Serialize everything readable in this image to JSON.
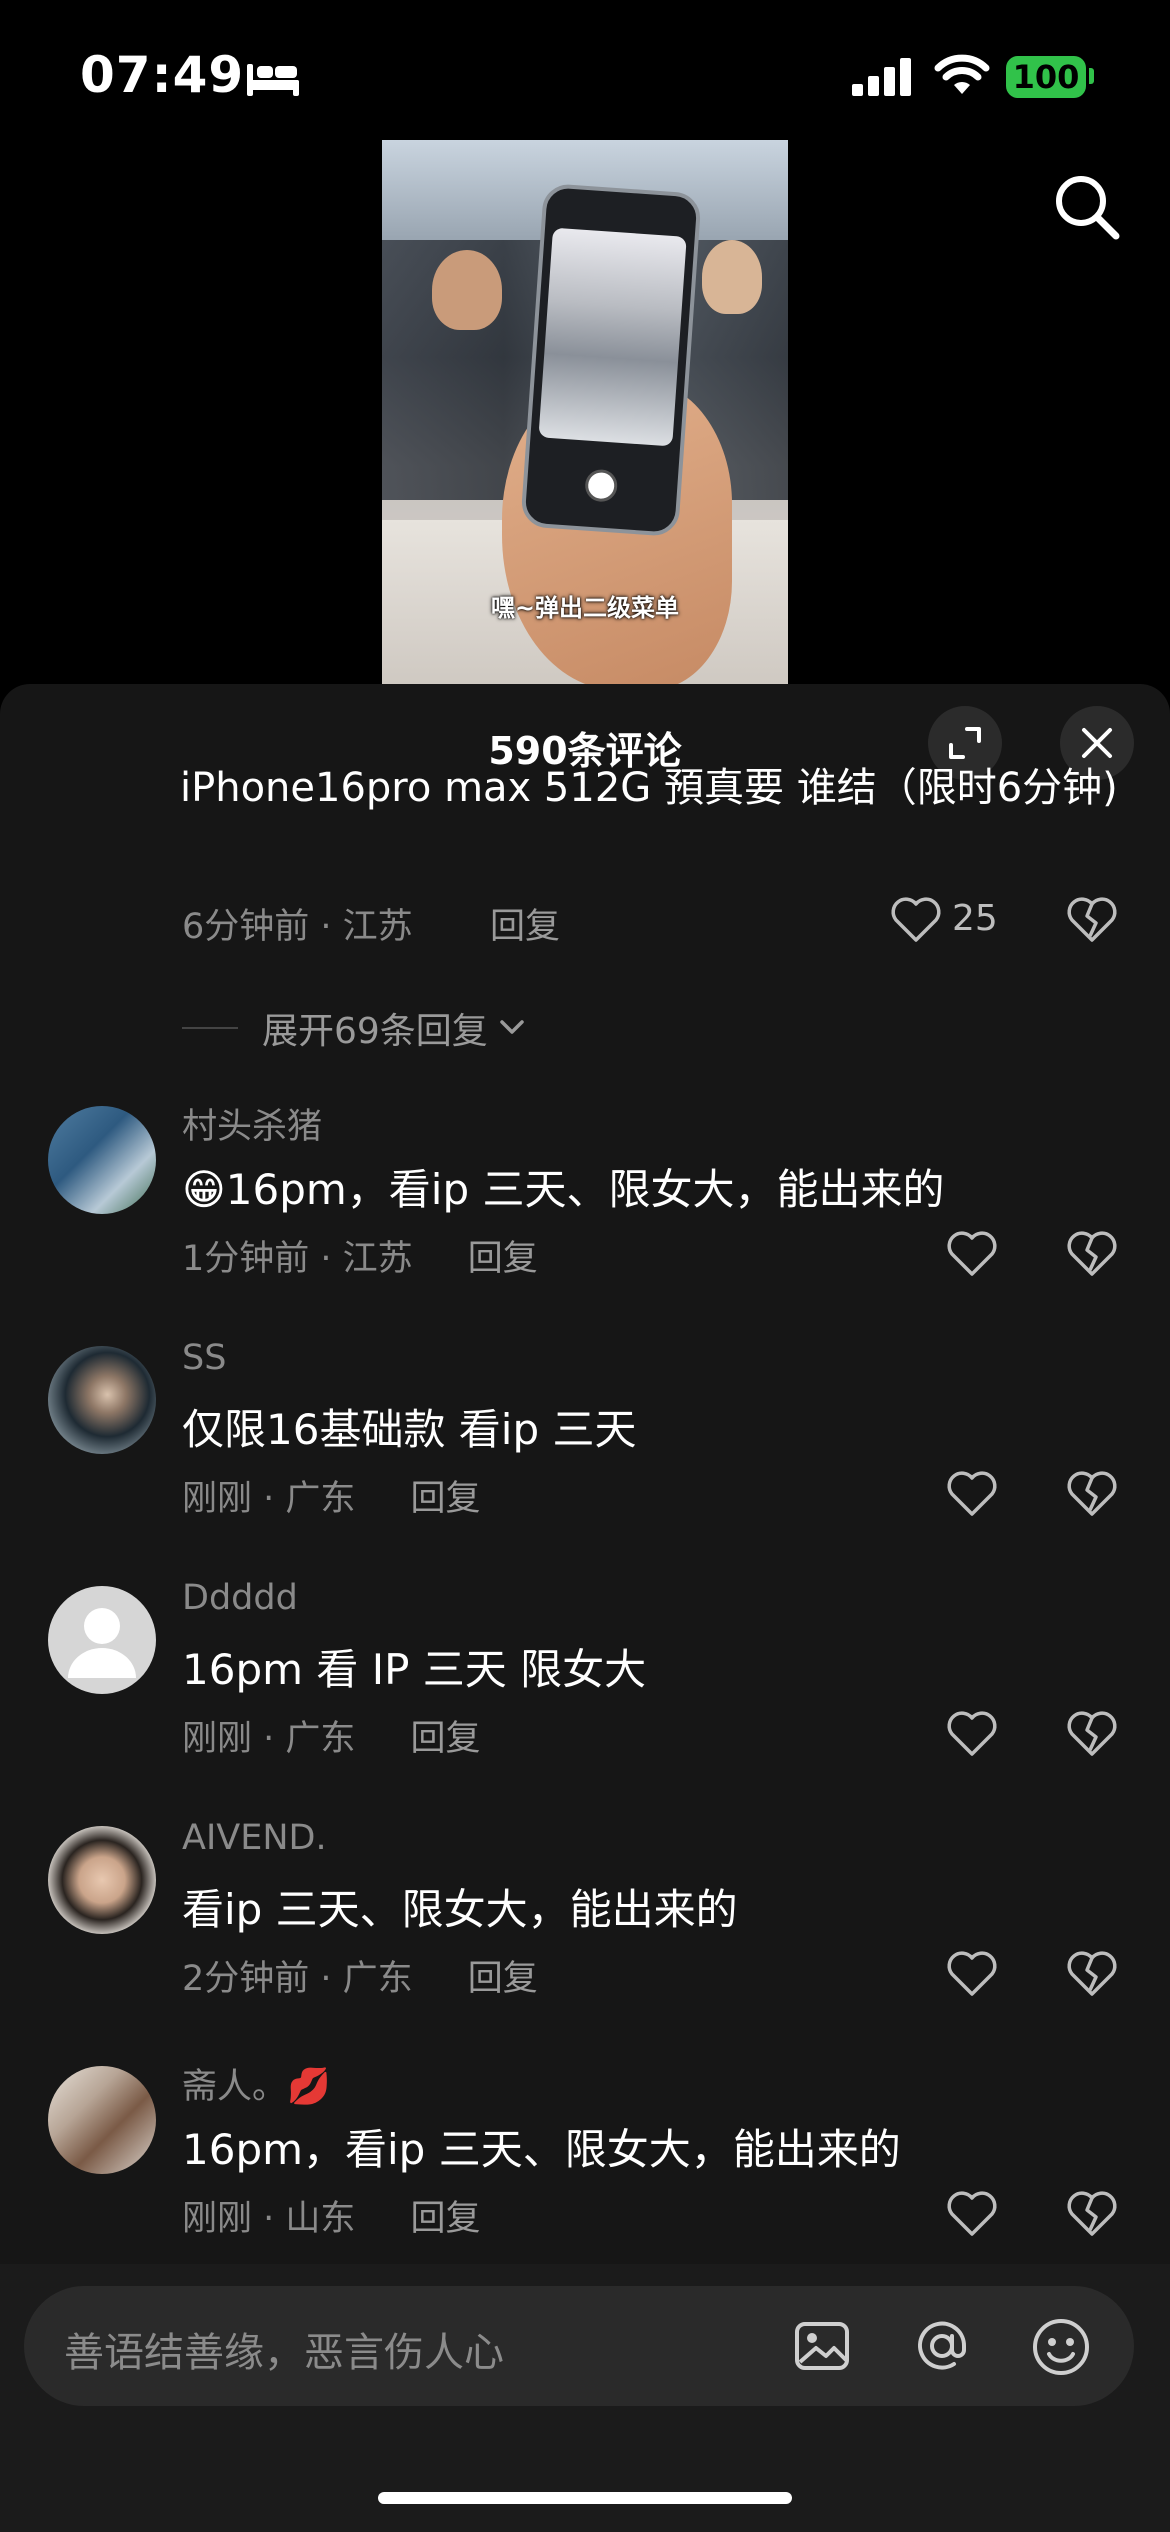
{
  "status": {
    "time": "07:49",
    "battery": "100"
  },
  "video": {
    "caption": "嘿~弹出二级菜单"
  },
  "panel": {
    "title": "590条评论"
  },
  "partial_comment": {
    "text": "iPhone16pro max 512G 預真要 谁结（限时6分钟)",
    "meta": "6分钟前 · 江苏",
    "reply": "回复",
    "likes": "25"
  },
  "expand_replies": "展开69条回复",
  "comments": [
    {
      "name": "村头杀猪",
      "text": "😁16pm，看ip  三天、限女大，能出来的",
      "meta": "1分钟前 · 江苏",
      "reply": "回复"
    },
    {
      "name": "SS",
      "text": "仅限16基础款 看ip 三天",
      "meta": "刚刚 · 广东",
      "reply": "回复"
    },
    {
      "name": "Ddddd",
      "text": "16pm  看 IP 三天 限女大",
      "meta": "刚刚 · 广东",
      "reply": "回复"
    },
    {
      "name": "AIVEND.",
      "text": "看ip  三天、限女大，能出来的",
      "meta": "2分钟前 · 广东",
      "reply": "回复"
    },
    {
      "name": "斋人。💋",
      "text": "16pm，看ip  三天、限女大，能出来的",
      "meta": "刚刚 · 山东",
      "reply": "回复"
    }
  ],
  "input": {
    "placeholder": "善语结善缘，恶言伤人心"
  },
  "colors": {
    "background": "#000000",
    "panel": "#161616",
    "battery": "#31c24a",
    "muted_text": "#8a8a8a"
  }
}
